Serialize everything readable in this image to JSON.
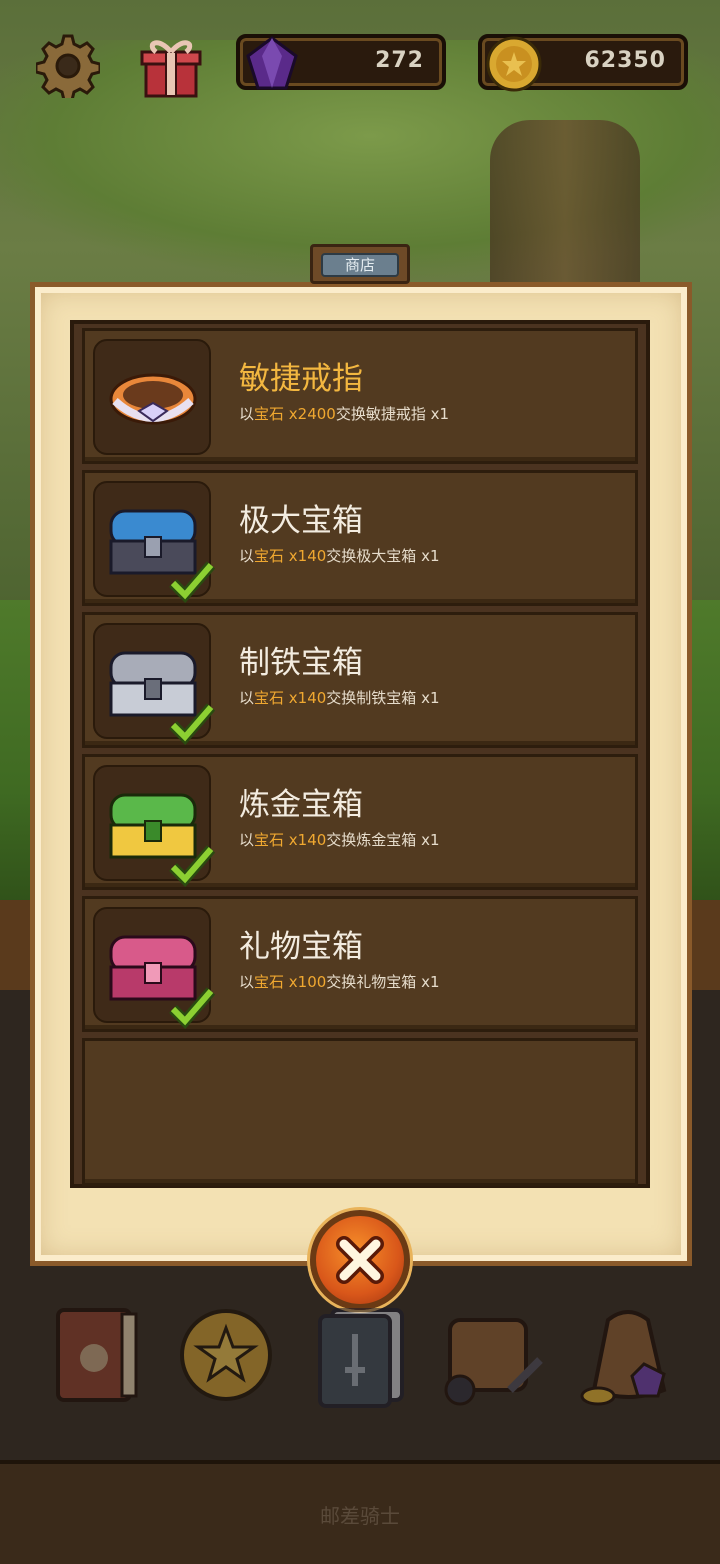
{
  "top_bar": {
    "gems_count": "272",
    "coins_count": "62350"
  },
  "shop": {
    "tab_label": "商店",
    "items": [
      {
        "title": "敏捷戒指",
        "desc_prefix": "以",
        "desc_currency": "宝石 x2400",
        "desc_suffix": "交换敏捷戒指 x1",
        "owned": false,
        "icon": "ring-icon"
      },
      {
        "title": "极大宝箱",
        "desc_prefix": "以",
        "desc_currency": "宝石 x140",
        "desc_suffix": "交换极大宝箱 x1",
        "owned": true,
        "icon": "blue-chest-icon"
      },
      {
        "title": "制铁宝箱",
        "desc_prefix": "以",
        "desc_currency": "宝石 x140",
        "desc_suffix": "交换制铁宝箱 x1",
        "owned": true,
        "icon": "iron-chest-icon"
      },
      {
        "title": "炼金宝箱",
        "desc_prefix": "以",
        "desc_currency": "宝石 x140",
        "desc_suffix": "交换炼金宝箱 x1",
        "owned": true,
        "icon": "gold-chest-icon"
      },
      {
        "title": "礼物宝箱",
        "desc_prefix": "以",
        "desc_currency": "宝石 x100",
        "desc_suffix": "交换礼物宝箱 x1",
        "owned": true,
        "icon": "gift-chest-icon"
      }
    ]
  },
  "bottom_nav": [
    "book-icon",
    "coin-icon",
    "card-deck-icon",
    "backpack-icon",
    "loot-bag-icon"
  ],
  "footer_label": "邮差骑士",
  "colors": {
    "accent_gold": "#f3b740",
    "highlight": "#f0a830",
    "close_button": "#d9571a"
  }
}
